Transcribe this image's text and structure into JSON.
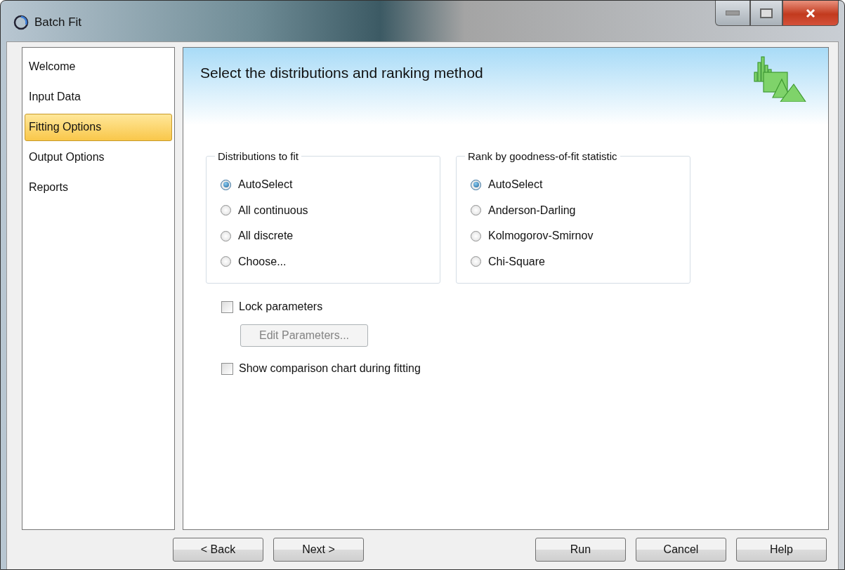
{
  "window": {
    "title": "Batch Fit"
  },
  "sidebar": {
    "items": [
      {
        "label": "Welcome",
        "selected": false
      },
      {
        "label": "Input Data",
        "selected": false
      },
      {
        "label": "Fitting Options",
        "selected": true
      },
      {
        "label": "Output Options",
        "selected": false
      },
      {
        "label": "Reports",
        "selected": false
      }
    ]
  },
  "header": {
    "title": "Select the distributions and ranking method"
  },
  "groups": [
    {
      "title": "Distributions to fit",
      "options": [
        {
          "label": "AutoSelect",
          "selected": true
        },
        {
          "label": "All continuous",
          "selected": false
        },
        {
          "label": "All discrete",
          "selected": false
        },
        {
          "label": "Choose...",
          "selected": false
        }
      ]
    },
    {
      "title": "Rank by goodness-of-fit statistic",
      "options": [
        {
          "label": "AutoSelect",
          "selected": true
        },
        {
          "label": "Anderson-Darling",
          "selected": false
        },
        {
          "label": "Kolmogorov-Smirnov",
          "selected": false
        },
        {
          "label": "Chi-Square",
          "selected": false
        }
      ]
    }
  ],
  "lock_parameters": {
    "label": "Lock parameters",
    "checked": false
  },
  "edit_parameters": {
    "label": "Edit Parameters...",
    "disabled": true
  },
  "show_chart": {
    "label": "Show comparison chart during fitting",
    "checked": false
  },
  "nav_buttons": [
    "< Back",
    "Next >"
  ],
  "action_buttons": [
    "Run",
    "Cancel",
    "Help"
  ]
}
